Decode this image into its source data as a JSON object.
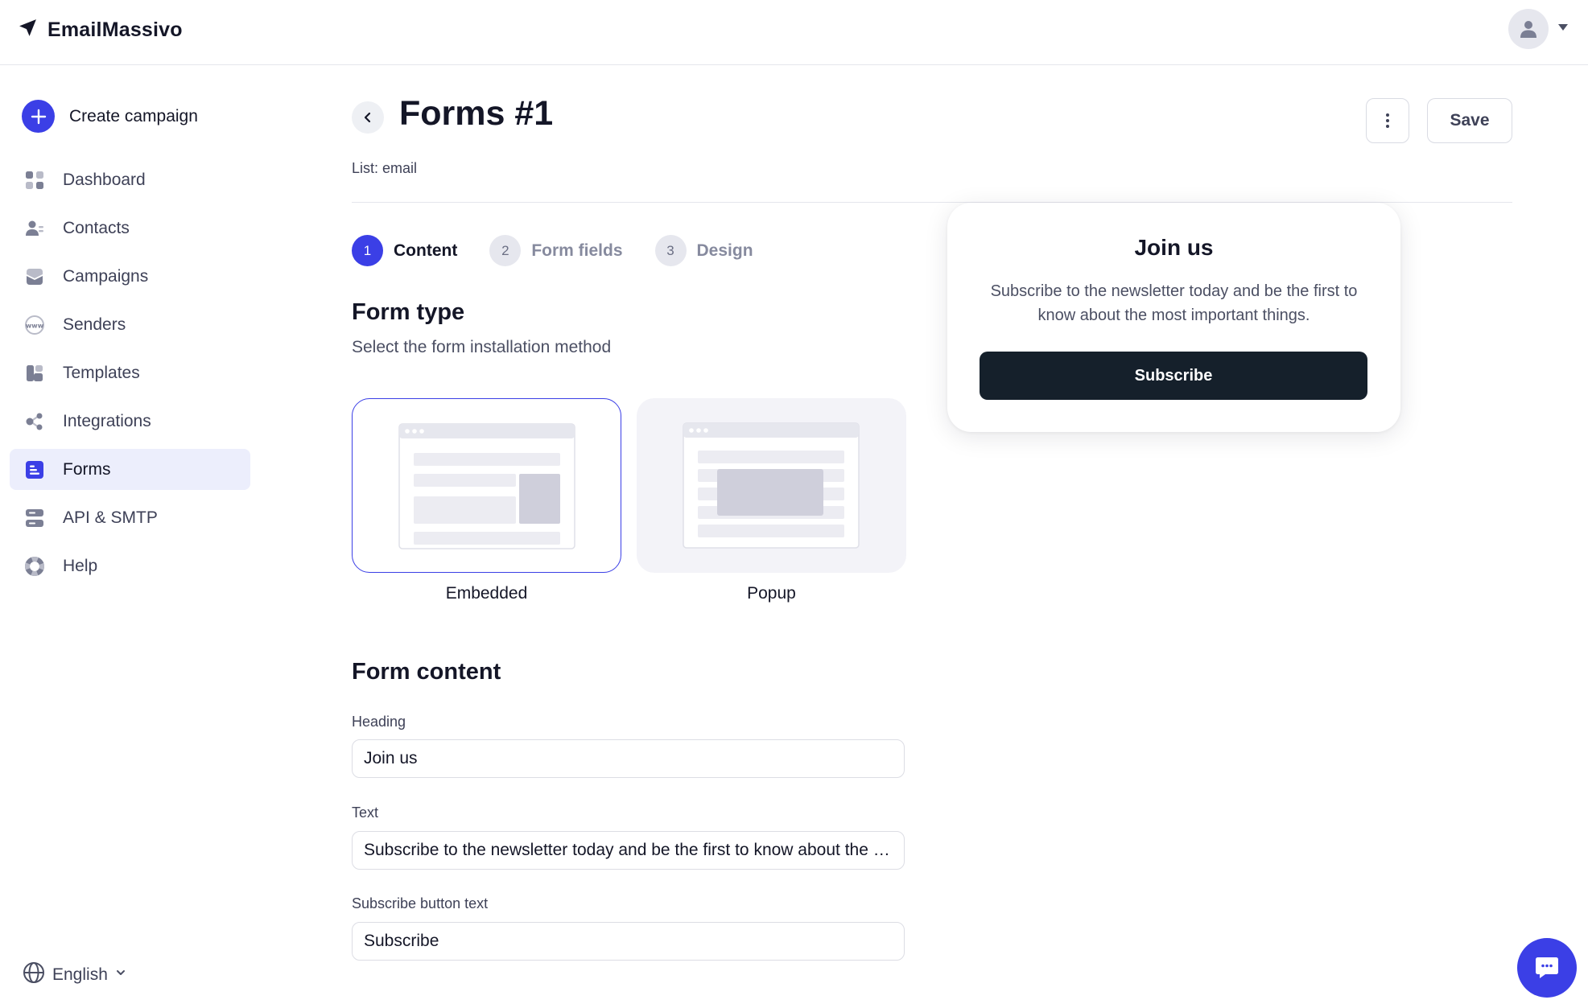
{
  "app": {
    "name": "EmailMassivo"
  },
  "sidebar": {
    "create_label": "Create campaign",
    "items": [
      {
        "label": "Dashboard",
        "icon": "dashboard-icon"
      },
      {
        "label": "Contacts",
        "icon": "contacts-icon"
      },
      {
        "label": "Campaigns",
        "icon": "campaigns-icon"
      },
      {
        "label": "Senders",
        "icon": "senders-icon"
      },
      {
        "label": "Templates",
        "icon": "templates-icon"
      },
      {
        "label": "Integrations",
        "icon": "integrations-icon"
      },
      {
        "label": "Forms",
        "icon": "forms-icon",
        "active": true
      },
      {
        "label": "API & SMTP",
        "icon": "api-icon"
      },
      {
        "label": "Help",
        "icon": "help-icon"
      }
    ],
    "language": "English"
  },
  "header": {
    "title": "Forms #1",
    "list_label": "List: email",
    "save_label": "Save"
  },
  "steps": [
    {
      "num": "1",
      "label": "Content",
      "active": true
    },
    {
      "num": "2",
      "label": "Form fields"
    },
    {
      "num": "3",
      "label": "Design"
    }
  ],
  "form_type": {
    "title": "Form type",
    "subtitle": "Select the form installation method",
    "options": [
      {
        "label": "Embedded",
        "selected": true
      },
      {
        "label": "Popup"
      }
    ]
  },
  "form_content": {
    "title": "Form content",
    "heading_label": "Heading",
    "heading_value": "Join us",
    "text_label": "Text",
    "text_value": "Subscribe to the newsletter today and be the first to know about the most important things.",
    "button_label": "Subscribe button text",
    "button_value": "Subscribe"
  },
  "preview": {
    "heading": "Join us",
    "text": "Subscribe to the newsletter today and be the first to know about the most important things.",
    "button": "Subscribe"
  },
  "colors": {
    "accent": "#3b3fe6",
    "dark": "#15202b",
    "active_bg": "#eceefc"
  }
}
